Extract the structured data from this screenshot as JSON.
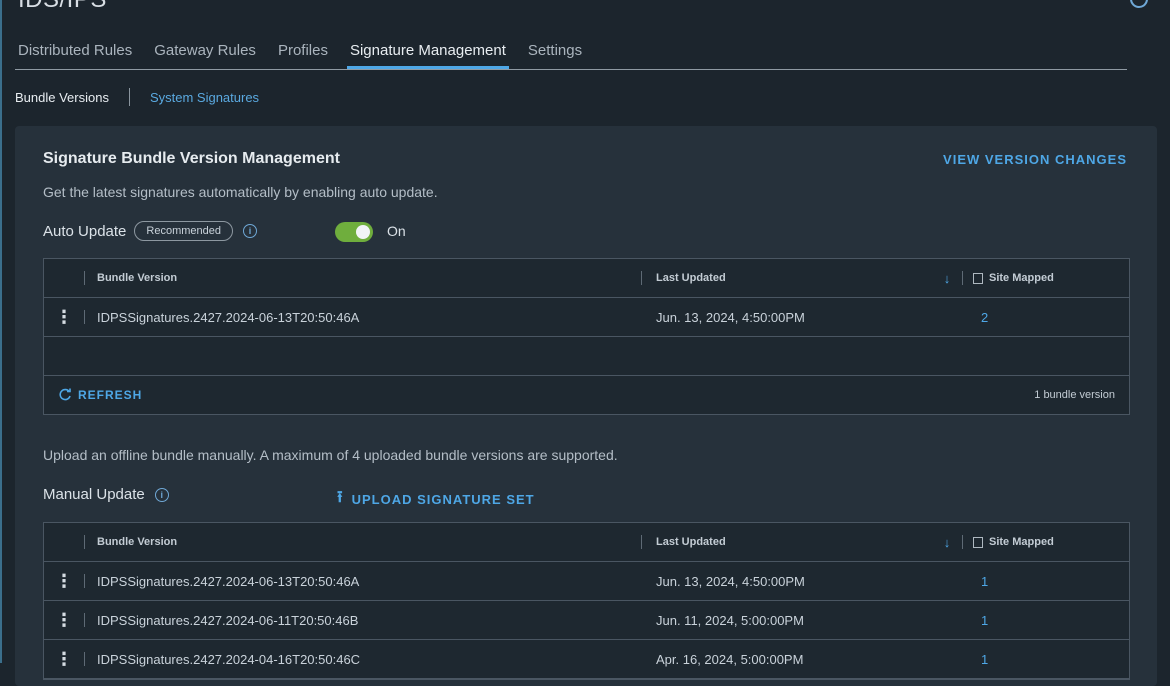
{
  "page": {
    "title": "IDS/IPS"
  },
  "tabs": [
    {
      "label": "Distributed Rules",
      "active": false
    },
    {
      "label": "Gateway Rules",
      "active": false
    },
    {
      "label": "Profiles",
      "active": false
    },
    {
      "label": "Signature Management",
      "active": true
    },
    {
      "label": "Settings",
      "active": false
    }
  ],
  "subnav": {
    "current": "Bundle Versions",
    "link": "System Signatures"
  },
  "card": {
    "title": "Signature Bundle Version Management",
    "view_changes": "VIEW VERSION CHANGES",
    "auto_desc": "Get the latest signatures automatically by enabling auto update.",
    "auto_label": "Auto Update",
    "auto_badge": "Recommended",
    "toggle_state": "On",
    "manual_desc": "Upload an offline bundle manually. A maximum of 4 uploaded bundle versions are supported.",
    "manual_label": "Manual Update",
    "upload_label": "UPLOAD SIGNATURE SET"
  },
  "columns": {
    "version": "Bundle Version",
    "updated": "Last Updated",
    "site": "Site Mapped"
  },
  "auto_grid": {
    "rows": [
      {
        "version": "IDPSSignatures.2427.2024-06-13T20:50:46A",
        "updated": "Jun. 13, 2024, 4:50:00PM",
        "site": "2"
      }
    ],
    "refresh": "REFRESH",
    "count": "1 bundle version"
  },
  "manual_grid": {
    "rows": [
      {
        "version": "IDPSSignatures.2427.2024-06-13T20:50:46A",
        "updated": "Jun. 13, 2024, 4:50:00PM",
        "site": "1"
      },
      {
        "version": "IDPSSignatures.2427.2024-06-11T20:50:46B",
        "updated": "Jun. 11, 2024, 5:00:00PM",
        "site": "1"
      },
      {
        "version": "IDPSSignatures.2427.2024-04-16T20:50:46C",
        "updated": "Apr. 16, 2024, 5:00:00PM",
        "site": "1"
      }
    ]
  },
  "icons": {
    "help": "help-circle-icon",
    "info": "info-icon",
    "refresh": "refresh-icon",
    "upload": "upload-icon",
    "sort": "sort-down-icon",
    "site": "site-map-icon",
    "row_menu": "kebab-menu-icon"
  },
  "colors": {
    "accent": "#4ea7e6",
    "toggle_on": "#6fae3d",
    "background": "#1c252d",
    "card": "#26313b"
  }
}
